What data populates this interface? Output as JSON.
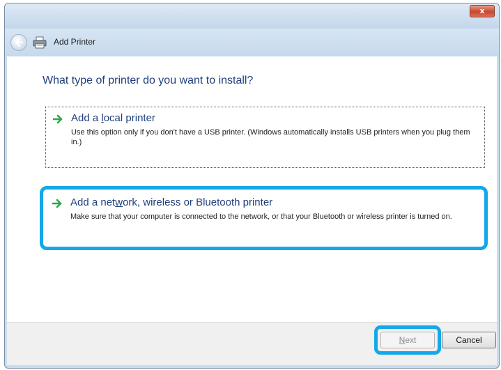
{
  "window": {
    "close_label": "x"
  },
  "nav": {
    "title": "Add Printer",
    "back_icon": "back-arrow-icon",
    "printer_icon": "printer-icon"
  },
  "main": {
    "heading": "What type of printer do you want to install?",
    "options": [
      {
        "title_pre": "Add a ",
        "title_accel": "l",
        "title_post": "ocal printer",
        "description": "Use this option only if you don't have a USB printer. (Windows automatically installs USB printers when you plug them in.)"
      },
      {
        "title_pre": "Add a net",
        "title_accel": "w",
        "title_post": "ork, wireless or Bluetooth printer",
        "description": "Make sure that your computer is connected to the network, or that your Bluetooth or wireless printer is turned on."
      }
    ]
  },
  "footer": {
    "next_accel": "N",
    "next_rest": "ext",
    "cancel_label": "Cancel"
  },
  "colors": {
    "highlight": "#14a8e8",
    "heading": "#1f3f7a",
    "arrow": "#2aa84a"
  }
}
